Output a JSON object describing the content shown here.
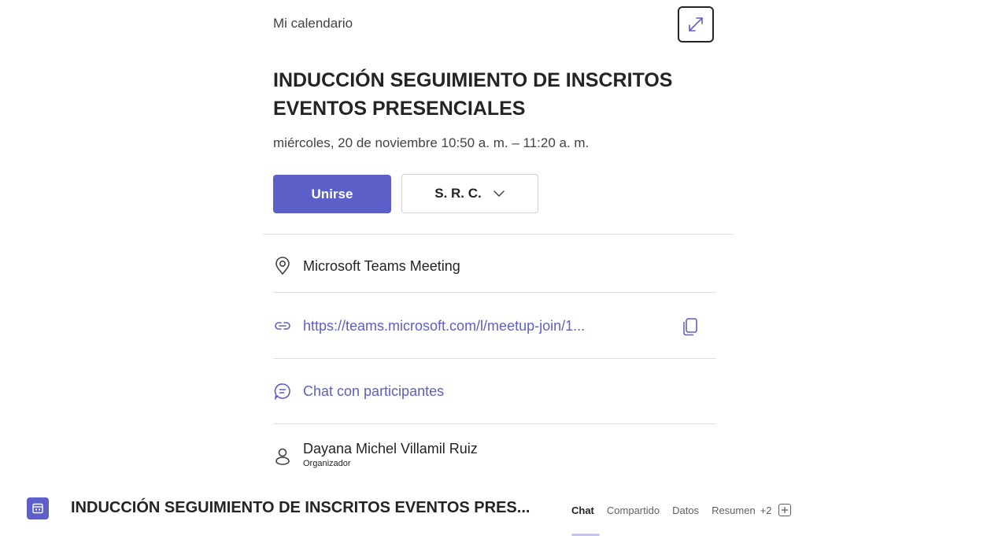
{
  "card": {
    "calendar_label": "Mi calendario",
    "expand_icon": "expand-icon",
    "title": "INDUCCIÓN SEGUIMIENTO DE INSCRITOS EVENTOS PRESENCIALES",
    "datetime": "miércoles, 20 de noviembre 10:50 a. m. – 11:20 a. m.",
    "join_label": "Unirse",
    "rsvp_label": "S. R. C.",
    "location": "Microsoft Teams Meeting",
    "meeting_link": "https://teams.microsoft.com/l/meetup-join/1...",
    "chat_link": "Chat con participantes",
    "organizer_name": "Dayana Michel Villamil Ruiz",
    "organizer_role": "Organizador"
  },
  "bottom_bar": {
    "title": "INDUCCIÓN SEGUIMIENTO DE INSCRITOS EVENTOS PRES...",
    "tabs": [
      "Chat",
      "Compartido",
      "Datos",
      "Resumen"
    ],
    "more_tabs": "+2"
  },
  "colors": {
    "accent": "#5b5fc7",
    "text": "#242424",
    "divider": "#e0e0e0"
  }
}
